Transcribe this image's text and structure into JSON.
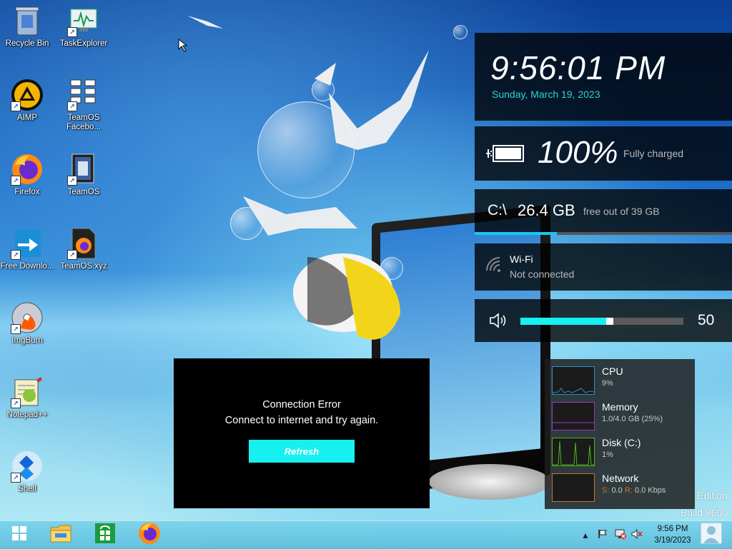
{
  "desktop_icons": [
    {
      "label": "Recycle Bin",
      "icon": "recycle-bin-icon"
    },
    {
      "label": "TaskExplorer",
      "icon": "task-explorer-icon"
    },
    {
      "label": "AIMP",
      "icon": "aimp-icon"
    },
    {
      "label": "TeamOS Facebo...",
      "icon": "document-list-icon"
    },
    {
      "label": "Firefox",
      "icon": "firefox-icon"
    },
    {
      "label": "TeamOS",
      "icon": "teamos-icon"
    },
    {
      "label": "Free Downlo...",
      "icon": "free-download-manager-icon"
    },
    {
      "label": "TeamOS.xyz",
      "icon": "teamos-xyz-icon"
    },
    {
      "label": "ImgBurn",
      "icon": "imgburn-icon"
    },
    {
      "label": "Notepad++",
      "icon": "notepad-plus-plus-icon"
    },
    {
      "label": "Shell",
      "icon": "shell-icon"
    }
  ],
  "clock_tile": {
    "time": "9:56:01 PM",
    "date": "Sunday, March 19, 2023"
  },
  "battery_tile": {
    "percent": "100%",
    "status": "Fully charged",
    "level": 1.0
  },
  "disk_tile": {
    "drive": "C:\\",
    "free": "26.4 GB",
    "suffix": "free out of 39 GB",
    "used_fraction": 0.32
  },
  "wifi_tile": {
    "name": "Wi-Fi",
    "status": "Not connected"
  },
  "volume_tile": {
    "value": "50",
    "level": 0.5
  },
  "perf_panel": {
    "cpu": {
      "title": "CPU",
      "value": "9%",
      "color": "#2a8fc9"
    },
    "memory": {
      "title": "Memory",
      "value": "1.0/4.0 GB (25%)",
      "color": "#9b36c0"
    },
    "disk": {
      "title": "Disk (C:)",
      "value": "1%",
      "color": "#4fb520"
    },
    "network": {
      "title": "Network",
      "send_label": "S:",
      "send_value": "0.0",
      "recv_label": "R:",
      "recv_value": "0.0 Kbps",
      "color": "#c9742a"
    }
  },
  "dialog": {
    "title": "Connection Error",
    "message": "Connect to internet and try again.",
    "button": "Refresh"
  },
  "watermark": {
    "edition": "Edition",
    "build": "Build 9600"
  },
  "taskbar": {
    "items": [
      "start-icon",
      "file-explorer-icon",
      "store-icon",
      "firefox-icon"
    ],
    "clock_time": "9:56 PM",
    "clock_date": "3/19/2023"
  },
  "colors": {
    "accent": "#17f0f0",
    "date_text": "#2ad4d4"
  }
}
